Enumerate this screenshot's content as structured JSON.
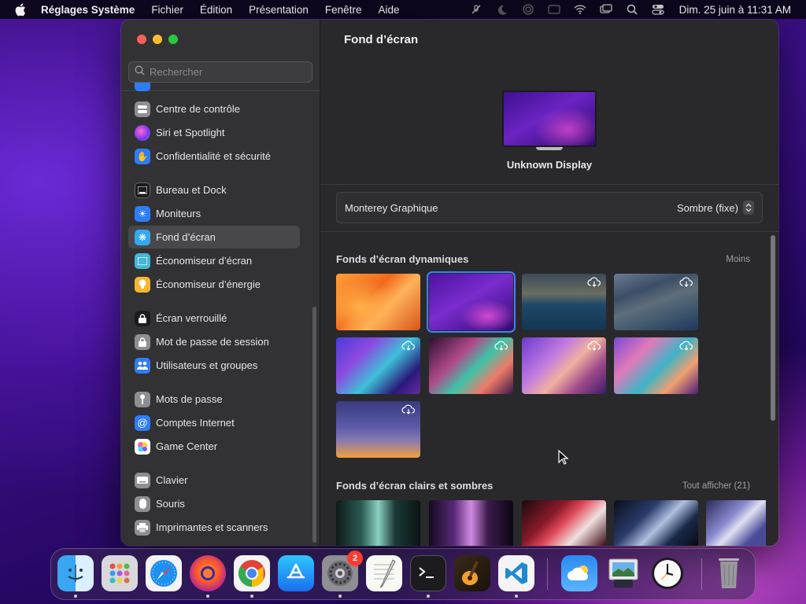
{
  "menubar": {
    "app_name": "Réglages Système",
    "menus": [
      "Fichier",
      "Édition",
      "Présentation",
      "Fenêtre",
      "Aide"
    ],
    "clock": "Dim. 25 juin à 11:31 AM",
    "status_icons": [
      "mic-off-icon",
      "focus-moon-icon",
      "airplay-icon",
      "keyboard-brightness-icon",
      "wifi-icon",
      "screen-mirroring-icon",
      "search-icon",
      "control-center-icon"
    ]
  },
  "search": {
    "placeholder": "Rechercher"
  },
  "sidebar": {
    "items": [
      {
        "label": "Centre de contrôle",
        "icon": "control-center-icon",
        "color": "#8e8e93"
      },
      {
        "label": "Siri et Spotlight",
        "icon": "siri-icon",
        "color": "#c43bd6"
      },
      {
        "label": "Confidentialité et sécurité",
        "icon": "hand-icon",
        "color": "#2f7cf6"
      },
      {
        "label": "Bureau et Dock",
        "icon": "dock-icon",
        "color": "#1c1c1e"
      },
      {
        "label": "Moniteurs",
        "icon": "sun-icon",
        "color": "#2f7cf6"
      },
      {
        "label": "Fond d’écran",
        "icon": "wallpaper-icon",
        "color": "#35a8f0"
      },
      {
        "label": "Économiseur d’écran",
        "icon": "screensaver-icon",
        "color": "#45b8d6"
      },
      {
        "label": "Économiseur d’énergie",
        "icon": "bulb-icon",
        "color": "#f7b52c"
      },
      {
        "label": "Écran verrouillé",
        "icon": "lock-icon",
        "color": "#1c1c1e"
      },
      {
        "label": "Mot de passe de session",
        "icon": "padlock-icon",
        "color": "#8e8e93"
      },
      {
        "label": "Utilisateurs et groupes",
        "icon": "users-icon",
        "color": "#2f7cf6"
      },
      {
        "label": "Mots de passe",
        "icon": "key-icon",
        "color": "#8e8e93"
      },
      {
        "label": "Comptes Internet",
        "icon": "at-icon",
        "color": "#2f7cf6"
      },
      {
        "label": "Game Center",
        "icon": "game-center-icon",
        "color": "#ffffff"
      },
      {
        "label": "Clavier",
        "icon": "keyboard-icon",
        "color": "#8e8e93"
      },
      {
        "label": "Souris",
        "icon": "mouse-icon",
        "color": "#8e8e93"
      },
      {
        "label": "Imprimantes et scanners",
        "icon": "printer-icon",
        "color": "#8e8e93"
      }
    ],
    "active_index": 5
  },
  "main": {
    "title": "Fond d’écran",
    "display_name": "Unknown Display",
    "wallpaper_name": "Monterey Graphique",
    "appearance_mode": "Sombre (fixe)",
    "sections": [
      {
        "title": "Fonds d’écran dynamiques",
        "link": "Moins"
      },
      {
        "title": "Fonds d’écran clairs et sombres",
        "link": "Tout afficher (21)"
      }
    ],
    "selected_thumbnail": 1
  },
  "dock": {
    "apps": [
      "Finder",
      "Launchpad",
      "Safari",
      "Firefox",
      "Chrome",
      "App Store",
      "Réglages Système",
      "TextEdit",
      "Terminal",
      "GarageBand",
      "Visual Studio Code",
      "Météo",
      "Aperçu",
      "Horloge",
      "Corbeille"
    ],
    "settings_badge": "2"
  },
  "colors": {
    "accent": "#3b82f6",
    "window_bg": "#2b2b2d",
    "sidebar_bg": "#323234"
  }
}
